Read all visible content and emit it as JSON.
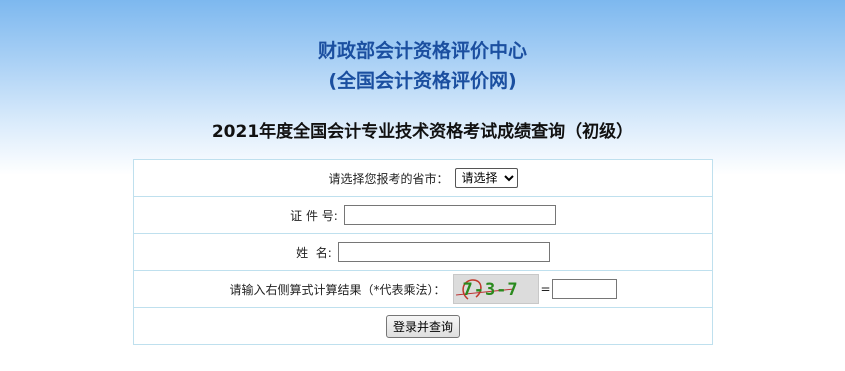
{
  "header": {
    "org_name": "财政部会计资格评价中心",
    "org_sub": "(全国会计资格评价网)",
    "exam_title": "2021年度全国会计专业技术资格考试成绩查询（初级）"
  },
  "form": {
    "province_label": "请选择您报考的省市：",
    "province_selected": "请选择",
    "id_label": "证 件 号:",
    "id_value": "",
    "name_label": "姓  名:",
    "name_value": "",
    "captcha_label": "请输入右侧算式计算结果（*代表乘法）：",
    "captcha_text": "7-3-7 _",
    "equals_sign": "=",
    "answer_value": "",
    "submit_label": "登录并查询"
  },
  "colors": {
    "title_blue": "#1b4fa0",
    "captcha_green": "#2a8a1e",
    "table_border": "#bfe0ee"
  }
}
